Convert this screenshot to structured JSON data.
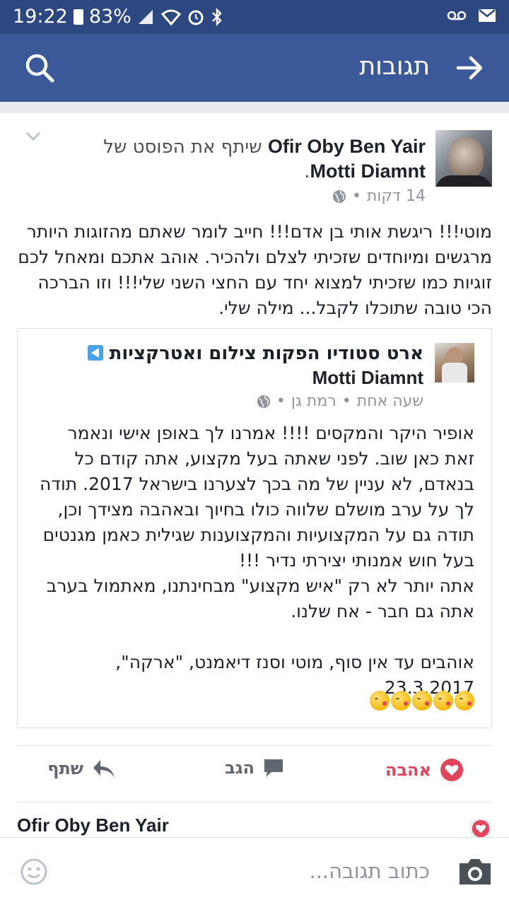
{
  "status_bar": {
    "time": "19:22",
    "battery": "83%"
  },
  "app_bar": {
    "title": "תגובות"
  },
  "post": {
    "author": "Ofir Oby Ben Yair",
    "shared_text": "שיתף את הפוסט של",
    "shared_owner": "Motti Diamnt",
    "time": "14 דקות",
    "body": "מוטי!!! ריגשת אותי בן אדם!!! חייב לומר שאתם מהזוגות היותר מרגשים ומיוחדים שזכיתי לצלם ולהכיר. אוהב אתכם ומאחל לכם זוגיות כמו שזכיתי למצוא יחד עם החצי השני שלי!!! וזו הברכה הכי טובה שתוכלו לקבל... מילה שלי.",
    "shared_post": {
      "page_name": "ארט סטודיו הפקות צילום ואטרקציות",
      "owner": "Motti Diamnt",
      "time": "שעה אחת",
      "location": "רמת גן",
      "body": "אופיר היקר והמקסים !!!! אמרנו לך באופן אישי ונאמר זאת כאן שוב. לפני שאתה בעל מקצוע, אתה קודם כל בנאדם, לא עניין של מה בכך לצערנו בישראל 2017. תודה לך על ערב מושלם שלווה כולו בחיוך ובאהבה מצידך וכן, תודה גם על המקצועיות והמקצוענות שגילית כאמן מגנטים בעל חוש אמנותי יצירתי נדיר !!!\nאתה יותר לא רק \"איש מקצוע\" מבחינתנו, מאתמול בערב אתה גם חבר - אח שלנו.\n\nאוהבים עד אין סוף, מוטי וסנז דיאמנט, \"ארקה\", 23.3.2017.",
      "emoji_count": 5
    }
  },
  "actions": {
    "love": "אהבה",
    "comment": "הגב",
    "share": "שתף"
  },
  "comment_preview": {
    "author": "Ofir Oby Ben Yair"
  },
  "composer": {
    "placeholder": "כתוב תגובה..."
  },
  "colors": {
    "header": "#3b5998",
    "status": "#2d4780",
    "love": "#e2445c",
    "meta": "#90949c"
  }
}
